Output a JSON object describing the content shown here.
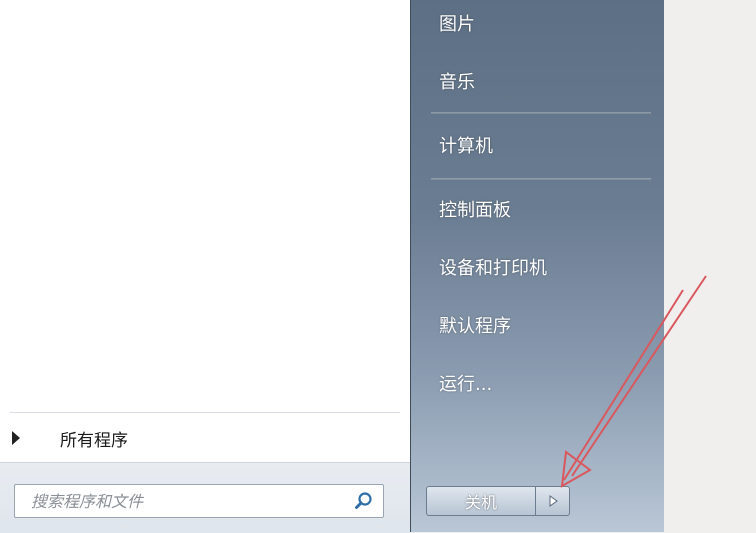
{
  "right_pane": {
    "items": [
      {
        "id": "pictures",
        "label": "图片"
      },
      {
        "id": "music",
        "label": "音乐"
      },
      {
        "id": "computer",
        "label": "计算机"
      },
      {
        "id": "control-panel",
        "label": "控制面板"
      },
      {
        "id": "devices-printers",
        "label": "设备和打印机"
      },
      {
        "id": "default-programs",
        "label": "默认程序"
      },
      {
        "id": "run",
        "label": "运行..."
      }
    ]
  },
  "left_pane": {
    "all_programs_label": "所有程序",
    "search": {
      "value": "",
      "placeholder": "搜索程序和文件"
    }
  },
  "shutdown": {
    "label": "关机"
  },
  "icons": {
    "search": "search-icon",
    "all_programs_arrow": "triangle-right-icon",
    "shutdown_arrow": "triangle-right-icon"
  },
  "colors": {
    "right_pane_top": "#5d6f84",
    "right_pane_bottom": "#b9c7d6",
    "annotation_arrow": "#d9585e"
  }
}
